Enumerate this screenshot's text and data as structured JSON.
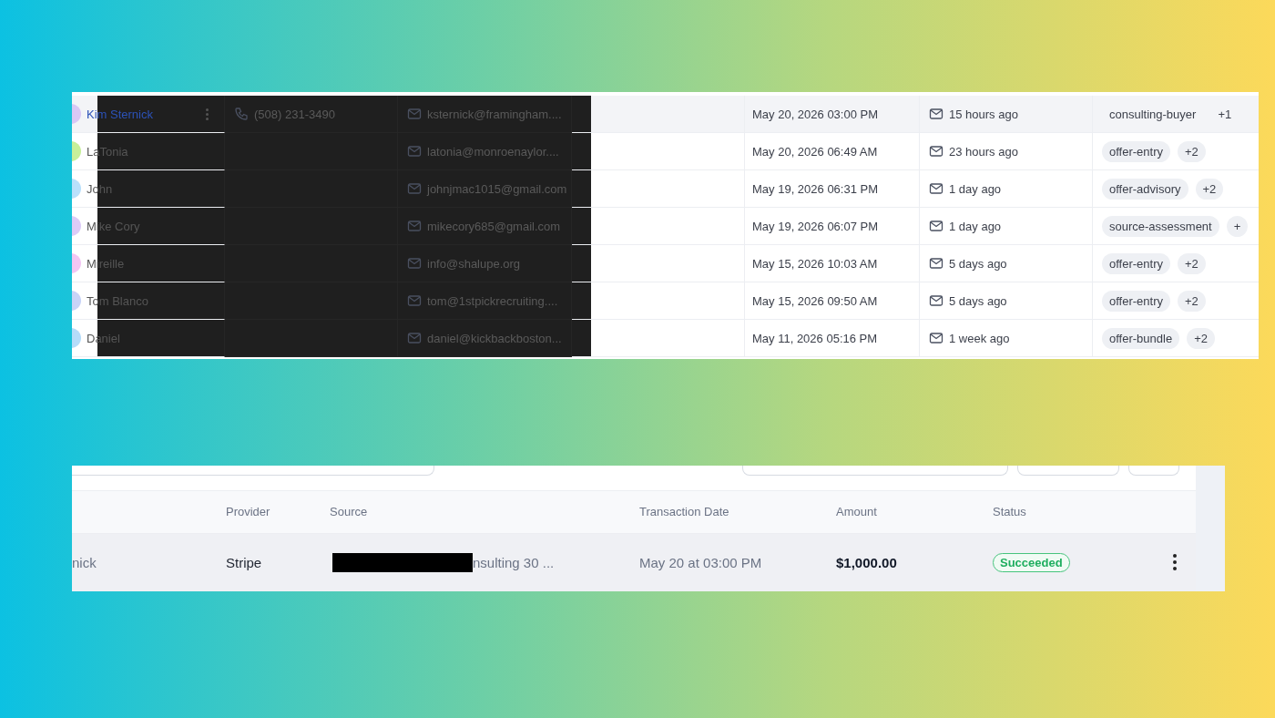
{
  "contacts_table": {
    "rows": [
      {
        "name": "Kim Sternick",
        "color": "#d9c8f5",
        "selected": true,
        "phone": "(508) 231-3490",
        "email": "ksternick@framingham....",
        "created": "May 20, 2026 03:00 PM",
        "last_contact": "15 hours ago",
        "tag": "consulting-buyer",
        "more_tags": "+1"
      },
      {
        "name": "LaTonia",
        "color": "#c6ef9a",
        "selected": false,
        "email": "latonia@monroenaylor....",
        "created": "May 20, 2026 06:49 AM",
        "last_contact": "23 hours ago",
        "tag": "offer-entry",
        "more_tags": "+2"
      },
      {
        "name": "John",
        "color": "#b9e0fb",
        "selected": false,
        "email": "johnjmac1015@gmail.com",
        "created": "May 19, 2026 06:31 PM",
        "last_contact": "1 day ago",
        "tag": "offer-advisory",
        "more_tags": "+2"
      },
      {
        "name": "Mike Cory",
        "color": "#ddcbf7",
        "selected": false,
        "email": "mikecory685@gmail.com",
        "created": "May 19, 2026 06:07 PM",
        "last_contact": "1 day ago",
        "tag": "source-assessment",
        "more_tags": "+"
      },
      {
        "name": "Mireille",
        "color": "#f3c6f3",
        "selected": false,
        "email": "info@shalupe.org",
        "created": "May 15, 2026 10:03 AM",
        "last_contact": "5 days ago",
        "tag": "offer-entry",
        "more_tags": "+2"
      },
      {
        "name": "Tom Blanco",
        "color": "#c7d3f7",
        "selected": false,
        "email": "tom@1stpickrecruiting....",
        "created": "May 15, 2026 09:50 AM",
        "last_contact": "5 days ago",
        "tag": "offer-entry",
        "more_tags": "+2"
      },
      {
        "name": "Daniel",
        "color": "#b5dcf9",
        "selected": false,
        "email": "daniel@kickbackboston...",
        "created": "May 11, 2026 05:16 PM",
        "last_contact": "1 week ago",
        "tag": "offer-bundle",
        "more_tags": "+2"
      }
    ]
  },
  "transactions_table": {
    "columns": [
      "Provider",
      "Source",
      "Transaction Date",
      "Amount",
      "Status"
    ],
    "rows": [
      {
        "name": "nick",
        "provider": "Stripe",
        "source": "nsulting 30 ...",
        "date": "May 20 at 03:00 PM",
        "amount": "$1,000.00",
        "status": "Succeeded"
      }
    ]
  }
}
